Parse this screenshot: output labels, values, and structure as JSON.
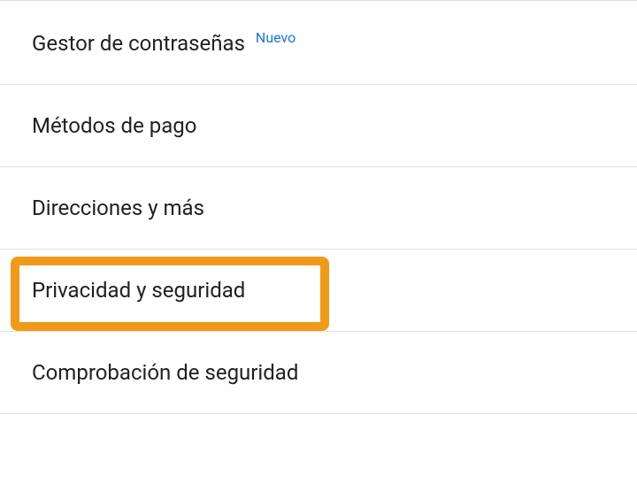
{
  "menu": {
    "items": [
      {
        "label": "Gestor de contraseñas",
        "badge": "Nuevo"
      },
      {
        "label": "Métodos de pago"
      },
      {
        "label": "Direcciones y más"
      },
      {
        "label": "Privacidad y seguridad",
        "highlighted": true
      },
      {
        "label": "Comprobación de seguridad"
      }
    ]
  }
}
